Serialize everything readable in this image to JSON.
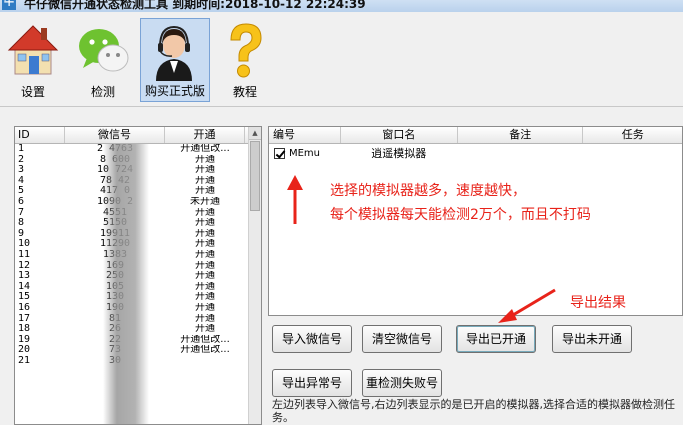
{
  "window": {
    "icon_text": "牛",
    "title": "牛仔微信开通状态检测工具   到期时间:2018-10-12 22:24:39"
  },
  "toolbar": {
    "settings": "设置",
    "detect": "检测",
    "buy": "购买正式版",
    "tutorial": "教程"
  },
  "left_table": {
    "headers": [
      "ID",
      "微信号",
      "开通"
    ],
    "rows": [
      [
        "1",
        "2   4763",
        "开通但改..."
      ],
      [
        "2",
        "8    600",
        "开通"
      ],
      [
        "3",
        "10   724",
        "开通"
      ],
      [
        "4",
        "78   42",
        "开通"
      ],
      [
        "5",
        "417   0",
        "开通"
      ],
      [
        "6",
        "1090   2",
        "未开通"
      ],
      [
        "7",
        "4551",
        "开通"
      ],
      [
        "8",
        "5150",
        "开通"
      ],
      [
        "9",
        "19911",
        "开通"
      ],
      [
        "10",
        "11290",
        "开通"
      ],
      [
        "11",
        "1383",
        "开通"
      ],
      [
        "12",
        "169",
        "开通"
      ],
      [
        "13",
        "250",
        "开通"
      ],
      [
        "14",
        "105",
        "开通"
      ],
      [
        "15",
        "130",
        "开通"
      ],
      [
        "16",
        "190",
        "开通"
      ],
      [
        "17",
        "81",
        "开通"
      ],
      [
        "18",
        "26",
        "开通"
      ],
      [
        "19",
        "22",
        "开通但改..."
      ],
      [
        "20",
        "73",
        "开通但改..."
      ],
      [
        "21",
        "30",
        ""
      ]
    ]
  },
  "right_table": {
    "headers": [
      "编号",
      "窗口名",
      "备注",
      "任务"
    ],
    "rows": [
      {
        "id": "MEmu",
        "window": "逍遥模拟器",
        "note": "",
        "task": ""
      }
    ]
  },
  "annotations": {
    "line1": "选择的模拟器越多，速度越快，",
    "line2": "每个模拟器每天能检测2万个，而且不打码",
    "export_result": "导出结果"
  },
  "buttons": {
    "import": "导入微信号",
    "clear": "清空微信号",
    "export_open": "导出已开通",
    "export_unopen": "导出未开通",
    "export_abnormal": "导出异常号",
    "redetect": "重检测失败号"
  },
  "hint": "左边列表导入微信号,右边列表显示的是已开启的模拟器,选择合适的模拟器做检测任务。",
  "colors": {
    "annotation": "#e8231a",
    "selected_tool": "#c9dcf2"
  }
}
